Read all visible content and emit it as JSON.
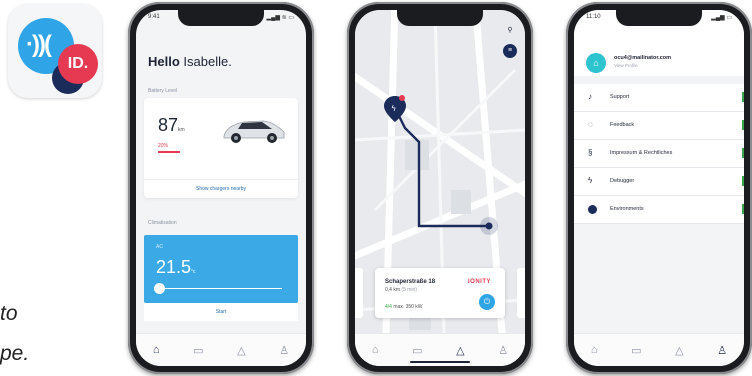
{
  "app_icon": {
    "badge": "ID.",
    "waves": "·))("
  },
  "left_text": {
    "line1": "to",
    "line2": "pe."
  },
  "phone1": {
    "status_time": "9:41",
    "status_icons": "▂▄▆ ≋ ▭",
    "greeting_bold": "Hello",
    "greeting_name": "Isabelle.",
    "battery_label": "Battery Level",
    "range_value": "87",
    "range_unit": "km",
    "battery_percent": "20%",
    "battery_level": 0.2,
    "chargers_link": "Show chargers nearby",
    "climate_label": "Climatisation",
    "climate_sub": "AC",
    "temperature": "21.5",
    "temp_unit": "°c",
    "start_label": "Start",
    "tabs": [
      "⌂",
      "▭",
      "△",
      "♙"
    ]
  },
  "phone2": {
    "map_search": "⚲",
    "map_menu": "≡",
    "station_name": "Schaperstraße 18",
    "station_distance": "0,4 km",
    "station_time": "(5 min)",
    "station_count": "4/4",
    "station_power": "max. 350 kW",
    "brand": "IONITY",
    "go_icon": "⏻",
    "tabs": [
      "⌂",
      "▭",
      "△",
      "♙"
    ]
  },
  "phone3": {
    "status_time": "11:10",
    "status_icons": "▂▄▆ ▭",
    "avatar_icon": "⌂",
    "email": "ocu4@mailinator.com",
    "email_sub": "View Profile",
    "menu": [
      {
        "icon": "♪",
        "label": "Support"
      },
      {
        "icon": "◌",
        "label": "Feedback"
      },
      {
        "icon": "§",
        "label": "Impressum & Rechtliches"
      },
      {
        "icon": "ϟ",
        "label": "Debugger"
      },
      {
        "icon": "",
        "label": "Environments"
      }
    ],
    "tabs": [
      "⌂",
      "▭",
      "△",
      "♙"
    ]
  },
  "colors": {
    "brand_blue": "#2fa4e7",
    "brand_red": "#e53a52",
    "navy": "#1b2b5a"
  }
}
